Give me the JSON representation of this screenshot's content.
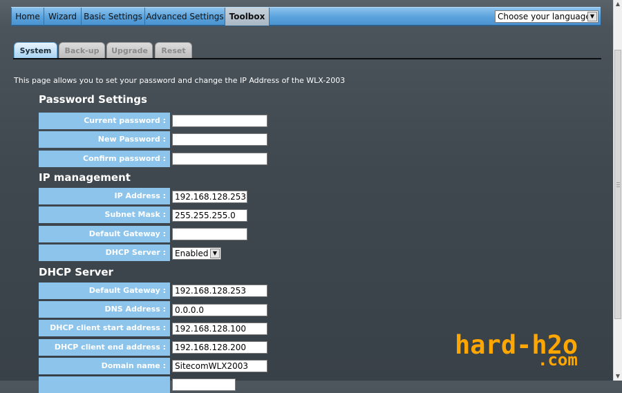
{
  "nav": {
    "items": [
      "Home",
      "Wizard",
      "Basic Settings",
      "Advanced Settings",
      "Toolbox"
    ],
    "active": "Toolbox",
    "language": "Choose your language"
  },
  "tabs": [
    "System",
    "Back-up",
    "Upgrade",
    "Reset"
  ],
  "description": "This page allows you to set your password and change the IP Address of the WLX-2003",
  "password": {
    "title": "Password Settings",
    "current_label": "Current password :",
    "new_label": "New Password :",
    "confirm_label": "Confirm password :"
  },
  "ip": {
    "title": "IP management",
    "ip_label": "IP Address :",
    "ip_value": "192.168.128.253",
    "mask_label": "Subnet Mask :",
    "mask_value": "255.255.255.0",
    "gateway_label": "Default Gateway :",
    "gateway_value": "",
    "dhcp_label": "DHCP Server :",
    "dhcp_value": "Enabled"
  },
  "dhcp": {
    "title": "DHCP Server",
    "gateway_label": "Default Gateway :",
    "gateway_value": "192.168.128.253",
    "dns_label": "DNS Address :",
    "dns_value": "0.0.0.0",
    "start_label": "DHCP client start address :",
    "start_value": "192.168.128.100",
    "end_label": "DHCP client end address :",
    "end_value": "192.168.128.200",
    "domain_label": "Domain name :",
    "domain_value": "SitecomWLX2003"
  },
  "watermark": {
    "line1": "hard-h2o",
    "line2": ".com",
    "color": "#ffa600"
  },
  "colors": {
    "nav": "#5aa2dc",
    "label_bg": "#8dc4ec",
    "background": "#434c53"
  }
}
